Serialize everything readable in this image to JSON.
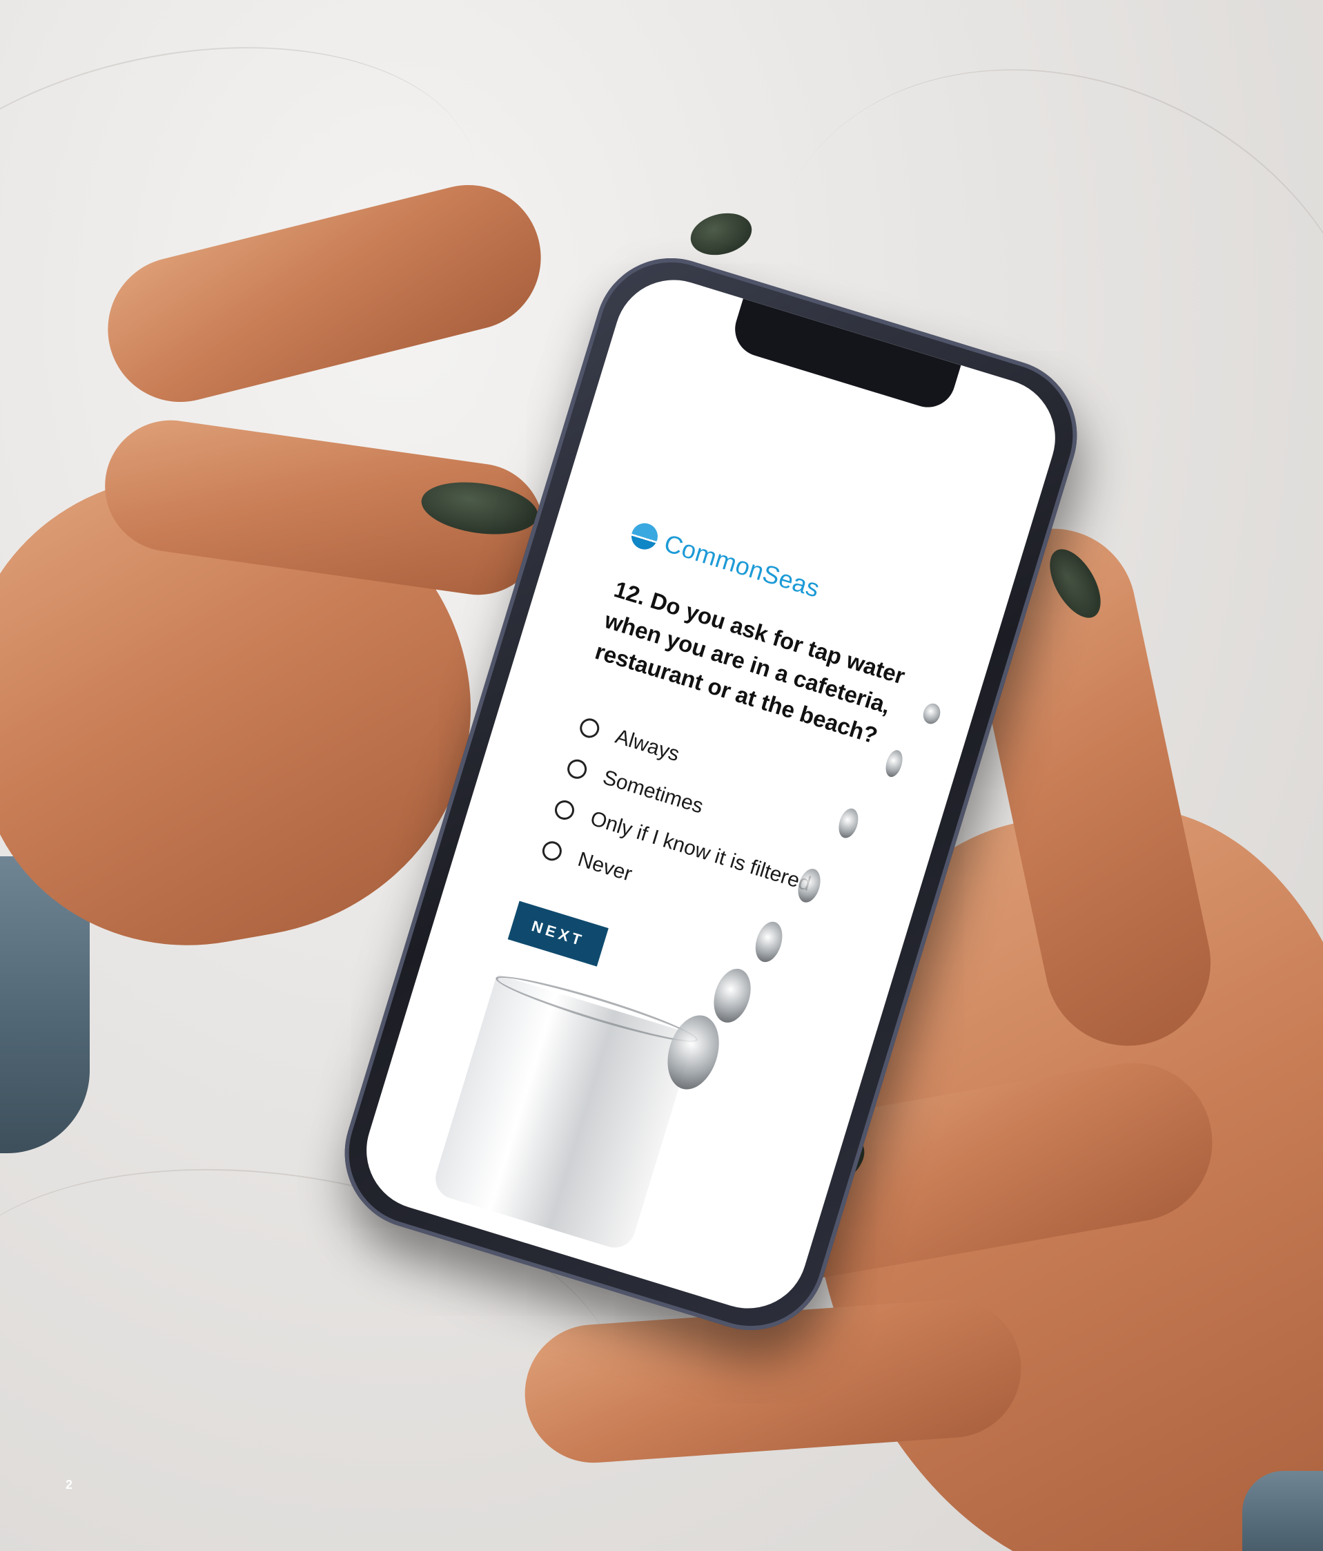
{
  "survey": {
    "brand_name": "CommonSeas",
    "question": "12. Do you ask for tap water when you are in a cafeteria, restaurant or at the beach?",
    "options": [
      "Always",
      "Sometimes",
      "Only if I know it is filtered",
      "Never"
    ],
    "next_label": "NEXT"
  },
  "page_number": "2",
  "colors": {
    "brand_blue": "#1c9ad6",
    "button_navy": "#0f4a6e",
    "nail_polish": "#2d382c"
  }
}
